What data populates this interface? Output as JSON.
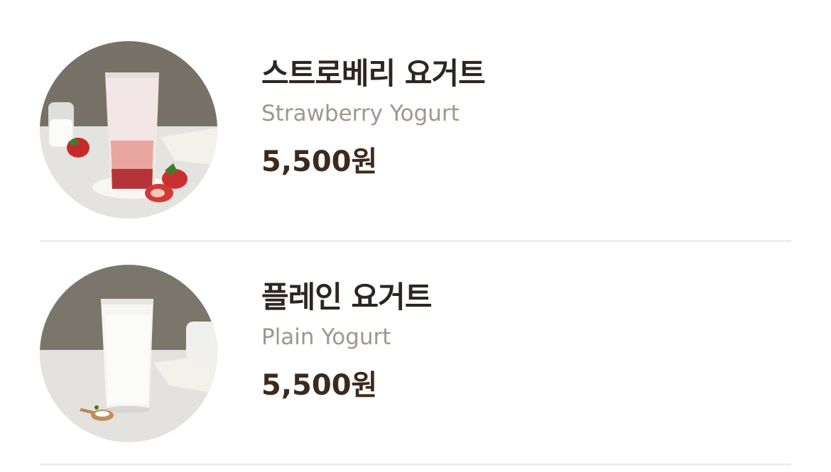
{
  "menu_items": [
    {
      "name_ko": "스트로베리 요거트",
      "name_en": "Strawberry Yogurt",
      "price": "5,500원",
      "image_icon": "strawberry-yogurt-drink-icon"
    },
    {
      "name_ko": "플레인 요거트",
      "name_en": "Plain Yogurt",
      "price": "5,500원",
      "image_icon": "plain-yogurt-drink-icon"
    }
  ],
  "colors": {
    "title": "#2d2622",
    "subtitle": "#a0968c",
    "price": "#3c2a1e",
    "divider": "#eeeeee"
  }
}
